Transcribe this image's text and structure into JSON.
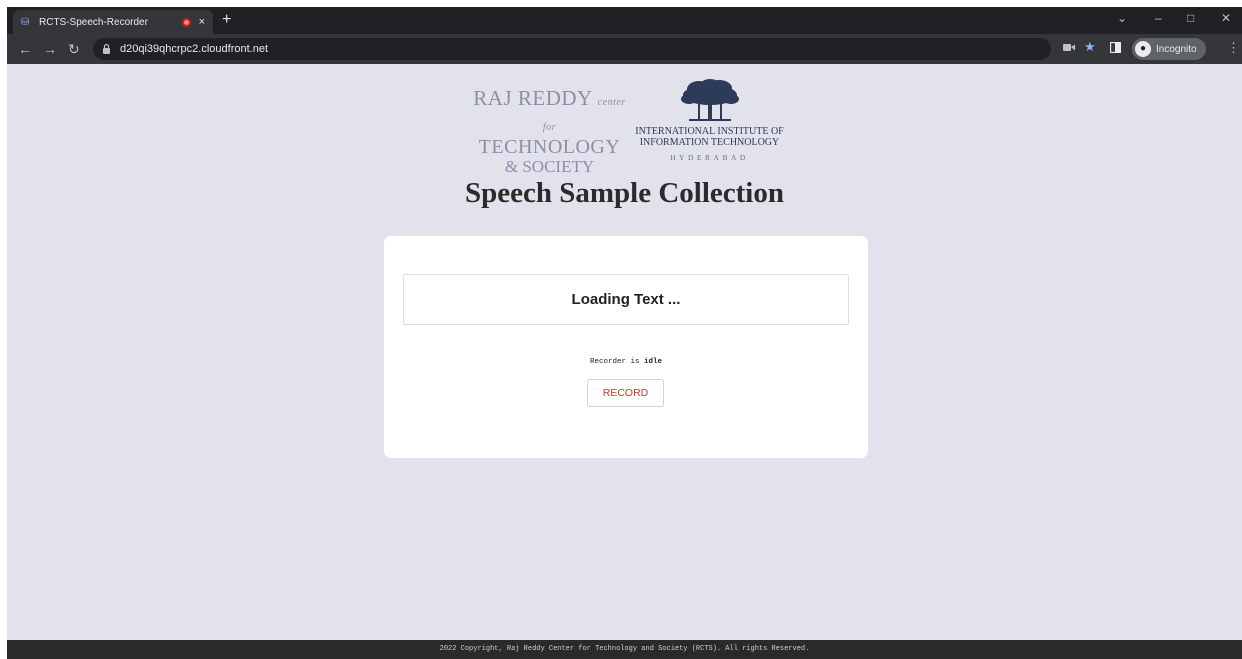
{
  "browser": {
    "tab_title": "RCTS-Speech-Recorder",
    "tab_close_glyph": "×",
    "new_tab_glyph": "+",
    "url": "d20qi39qhcrpc2.cloudfront.net",
    "incognito_label": "Incognito",
    "icons": [
      "minimize-icon",
      "maximize-icon",
      "close-window-icon",
      "back-icon",
      "forward-icon",
      "reload-icon",
      "lock-icon",
      "camera-icon",
      "star-icon",
      "side-panel-icon",
      "menu-icon"
    ]
  },
  "header": {
    "rrcts_logo": {
      "line1": "RAJ REDDY",
      "line1_script": "center for",
      "line2": "TECHNOLOGY",
      "line3": "& SOCIETY"
    },
    "iiit_logo": {
      "line1": "INTERNATIONAL INSTITUTE OF",
      "line2": "INFORMATION TECHNOLOGY",
      "line3": "HYDERABAD"
    },
    "title": "Speech Sample Collection"
  },
  "card": {
    "prompt_text": "Loading Text ...",
    "status_prefix": "Recorder is ",
    "status_value": "idle",
    "record_button": "RECORD"
  },
  "footer": {
    "text": "2022 Copyright, Raj Reddy Center for Technology and Society (RCTS). All rights Reserved."
  },
  "colors": {
    "page_bg": "#e1e2eb",
    "card_bg": "#ffffff",
    "record_text": "#c0392b",
    "footer_bg": "#2a2a2a",
    "chrome_dark": "#202124",
    "chrome_toolbar": "#35363a"
  }
}
